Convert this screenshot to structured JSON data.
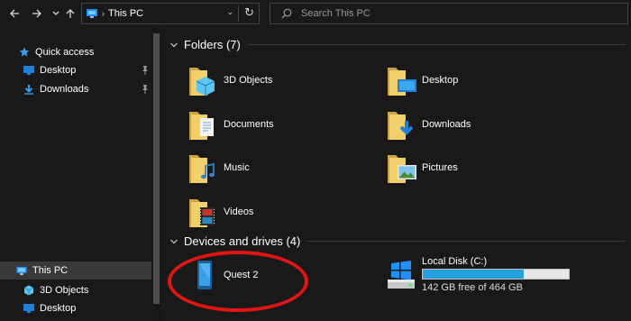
{
  "address": {
    "location": "This PC"
  },
  "search": {
    "placeholder": "Search This PC"
  },
  "sidebar": {
    "items": [
      {
        "label": "Quick access",
        "icon": "star-icon"
      },
      {
        "label": "Desktop",
        "icon": "desktop-folder-icon",
        "pinned": true
      },
      {
        "label": "Downloads",
        "icon": "download-arrow-icon",
        "pinned": true
      },
      {
        "label": "This PC",
        "icon": "computer-icon",
        "selected": true
      },
      {
        "label": "3D Objects",
        "icon": "cube-icon"
      },
      {
        "label": "Desktop",
        "icon": "desktop-folder-icon"
      }
    ]
  },
  "main": {
    "folders_header": "Folders (7)",
    "folders": [
      {
        "label": "3D Objects",
        "icon": "3d-objects-folder-icon"
      },
      {
        "label": "Desktop",
        "icon": "desktop-folder-icon"
      },
      {
        "label": "Documents",
        "icon": "documents-folder-icon"
      },
      {
        "label": "Downloads",
        "icon": "downloads-folder-icon"
      },
      {
        "label": "Music",
        "icon": "music-folder-icon"
      },
      {
        "label": "Pictures",
        "icon": "pictures-folder-icon"
      },
      {
        "label": "Videos",
        "icon": "videos-folder-icon"
      }
    ],
    "devices_header": "Devices and drives (4)",
    "devices": [
      {
        "label": "Quest 2",
        "icon": "phone-device-icon"
      }
    ],
    "drive": {
      "label": "Local Disk (C:)",
      "free_text": "142 GB free of 464 GB",
      "used_fraction": 0.694,
      "icon": "windows-drive-icon"
    }
  },
  "colors": {
    "background": "#191919",
    "accent": "#26a0da",
    "annotation": "#e01515",
    "selection": "#393939"
  }
}
